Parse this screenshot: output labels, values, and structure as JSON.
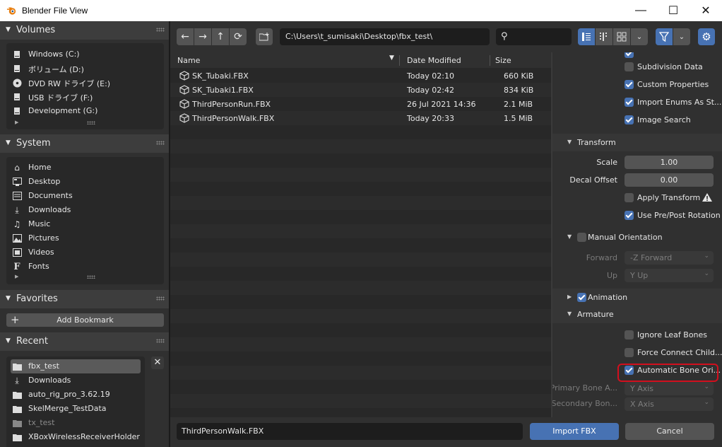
{
  "window": {
    "title": "Blender File View",
    "minimize": "—",
    "maximize": "☐",
    "close": "✕"
  },
  "sidebar": {
    "volumes": {
      "title": "Volumes",
      "items": [
        {
          "label": "Windows (C:)",
          "icon": "hard-drive-icon"
        },
        {
          "label": "ボリューム (D:)",
          "icon": "hard-drive-icon"
        },
        {
          "label": "DVD RW ドライブ (E:)",
          "icon": "disc-icon"
        },
        {
          "label": "USB ドライブ (F:)",
          "icon": "hard-drive-icon"
        },
        {
          "label": "Development (G:)",
          "icon": "hard-drive-icon"
        }
      ]
    },
    "system": {
      "title": "System",
      "items": [
        {
          "label": "Home",
          "icon": "home-icon"
        },
        {
          "label": "Desktop",
          "icon": "desktop-icon"
        },
        {
          "label": "Documents",
          "icon": "document-icon"
        },
        {
          "label": "Downloads",
          "icon": "download-icon"
        },
        {
          "label": "Music",
          "icon": "music-icon"
        },
        {
          "label": "Pictures",
          "icon": "picture-icon"
        },
        {
          "label": "Videos",
          "icon": "video-icon"
        },
        {
          "label": "Fonts",
          "icon": "font-icon"
        }
      ]
    },
    "favorites": {
      "title": "Favorites",
      "add_bookmark": "Add Bookmark"
    },
    "recent": {
      "title": "Recent",
      "items": [
        {
          "label": "fbx_test",
          "icon": "folder-icon"
        },
        {
          "label": "Downloads",
          "icon": "download-icon"
        },
        {
          "label": "auto_rig_pro_3.62.19",
          "icon": "folder-icon"
        },
        {
          "label": "SkelMerge_TestData",
          "icon": "folder-icon"
        },
        {
          "label": "tx_test",
          "icon": "folder-icon"
        },
        {
          "label": "XBoxWirelessReceiverHolder",
          "icon": "folder-icon"
        }
      ]
    }
  },
  "toolbar": {
    "path": "C:\\Users\\t_sumisaki\\Desktop\\fbx_test\\",
    "search_value": ""
  },
  "filelist": {
    "columns": {
      "name": "Name",
      "date": "Date Modified",
      "size": "Size"
    },
    "rows": [
      {
        "name": "SK_Tubaki.FBX",
        "date": "Today 02:10",
        "size": "660 KiB"
      },
      {
        "name": "SK_Tubaki1.FBX",
        "date": "Today 02:42",
        "size": "834 KiB"
      },
      {
        "name": "ThirdPersonRun.FBX",
        "date": "26 Jul 2021 14:36",
        "size": "2.1 MiB"
      },
      {
        "name": "ThirdPersonWalk.FBX",
        "date": "Today 20:33",
        "size": "1.5 MiB"
      }
    ]
  },
  "props": {
    "top_checks": [
      {
        "label": "Subdivision Data",
        "checked": false
      },
      {
        "label": "Custom Properties",
        "checked": true
      },
      {
        "label": "Import Enums As St...",
        "checked": true
      },
      {
        "label": "Image Search",
        "checked": true
      }
    ],
    "transform": {
      "title": "Transform",
      "scale_label": "Scale",
      "scale_value": "1.00",
      "decal_label": "Decal Offset",
      "decal_value": "0.00",
      "apply_transform": "Apply Transform",
      "use_prepost": "Use Pre/Post Rotation"
    },
    "manual_orientation": {
      "title": "Manual Orientation",
      "forward_label": "Forward",
      "forward_value": "-Z Forward",
      "up_label": "Up",
      "up_value": "Y Up"
    },
    "animation": {
      "title": "Animation"
    },
    "armature": {
      "title": "Armature",
      "ignore_leaf": "Ignore Leaf Bones",
      "force_connect": "Force Connect Child...",
      "auto_bone": "Automatic Bone Ori...",
      "primary_label": "Primary Bone A...",
      "primary_value": "Y Axis",
      "secondary_label": "Secondary Bon...",
      "secondary_value": "X Axis"
    }
  },
  "bottom": {
    "filename": "ThirdPersonWalk.FBX",
    "import_label": "Import FBX",
    "cancel_label": "Cancel"
  },
  "colors": {
    "accent": "#4772b3",
    "highlight": "#d20f1e"
  }
}
